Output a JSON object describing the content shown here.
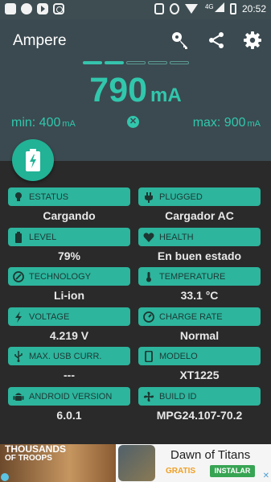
{
  "status_bar": {
    "time": "20:52",
    "network": "4G",
    "icons": [
      "photo-icon",
      "whatsapp-icon",
      "youtube-icon",
      "instagram-icon",
      "vibrate-icon",
      "alarm-icon",
      "wifi-icon",
      "signal-icon",
      "battery-icon"
    ]
  },
  "app": {
    "title": "Ampere",
    "accent_color": "#31c7ad",
    "toolbar_icons": [
      "key-icon",
      "share-icon",
      "settings-icon"
    ],
    "page_indicator": {
      "total": 5,
      "active": [
        0,
        1
      ]
    }
  },
  "current": {
    "value": "790",
    "unit": "mA",
    "min_label": "min: 400",
    "min_unit": "mA",
    "max_label": "max: 900",
    "max_unit": "mA"
  },
  "fab_icon": "battery-charging-icon",
  "info": {
    "status": {
      "label": "ESTATUS",
      "value": "Cargando",
      "icon": "bulb-icon"
    },
    "plugged": {
      "label": "PLUGGED",
      "value": "Cargador AC",
      "icon": "plug-icon"
    },
    "level": {
      "label": "LEVEL",
      "value": "79%",
      "icon": "battery-icon"
    },
    "health": {
      "label": "HEALTH",
      "value": "En buen estado",
      "icon": "heart-icon"
    },
    "technology": {
      "label": "TECHNOLOGY",
      "value": "Li-ion",
      "icon": "technology-icon"
    },
    "temperature": {
      "label": "TEMPERATURE",
      "value": "33.1 °C",
      "icon": "thermometer-icon"
    },
    "voltage": {
      "label": "VOLTAGE",
      "value": "4.219 V",
      "icon": "bolt-icon"
    },
    "charge_rate": {
      "label": "CHARGE RATE",
      "value": "Normal",
      "icon": "gauge-icon"
    },
    "max_usb": {
      "label": "MAX. USB CURR.",
      "value": "---",
      "icon": "usb-icon"
    },
    "model": {
      "label": "MODELO",
      "value": "XT1225",
      "icon": "phone-icon"
    },
    "android": {
      "label": "ANDROID VERSION",
      "value": "6.0.1",
      "icon": "android-icon"
    },
    "build": {
      "label": "BUILD ID",
      "value": "MPG24.107-70.2",
      "icon": "fan-icon"
    }
  },
  "ad": {
    "brand_line1": "THOUSANDS",
    "brand_line2": "OF TROOPS",
    "title": "Dawn of Titans",
    "price": "GRATIS",
    "install": "INSTALAR"
  }
}
